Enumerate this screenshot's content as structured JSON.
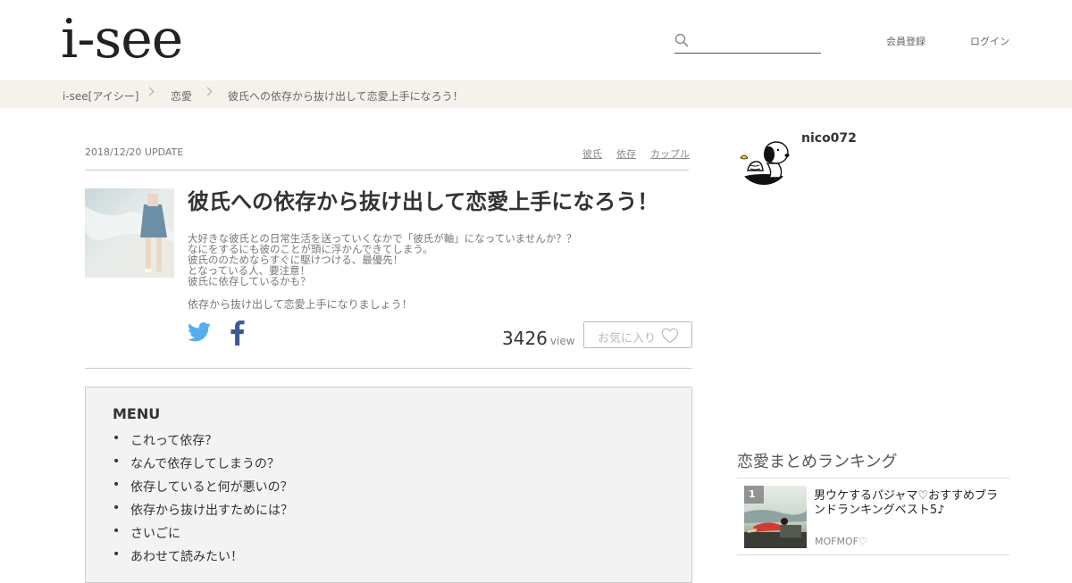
{
  "header": {
    "logo": "i-see",
    "search": {
      "placeholder": ""
    },
    "register_label": "会員登録",
    "login_label": "ログイン"
  },
  "breadcrumb": [
    "i-see[アイシー]",
    "恋愛",
    "彼氏への依存から抜け出して恋愛上手になろう！"
  ],
  "article": {
    "date": "2018/12/20 UPDATE",
    "tags": [
      "彼氏",
      "依存",
      "カップル"
    ],
    "title": "彼氏への依存から抜け出して恋愛上手になろう！",
    "intro_lines": [
      "大好きな彼氏との日常生活を送っていくなかで「彼氏が軸」になっていませんか？？",
      "なにをするにも彼のことが頭に浮かんできてしまう。",
      "彼氏ののためならすぐに駆けつける、最優先！",
      "となっている人、要注意！",
      "彼氏に依存しているかも？"
    ],
    "intro_last": "依存から抜け出して恋愛上手になりましょう！",
    "views": "3426",
    "views_label": "view",
    "favorite_label": "お気に入り",
    "share_icons": [
      "twitter-icon",
      "facebook-icon"
    ]
  },
  "menu": {
    "title": "MENU",
    "items": [
      "これって依存？",
      "なんで依存してしまうの？",
      "依存していると何が悪いの？",
      "依存から抜け出すためには？",
      "さいごに",
      "あわせて読みたい！"
    ]
  },
  "sidebar": {
    "author_name": "nico072",
    "ranking_title": "恋愛まとめランキング",
    "ranking": [
      {
        "rank": "1",
        "title": "男ウケするパジャマ♡おすすめブランドランキングベスト5♪",
        "author": "MOFMOF♡"
      }
    ]
  },
  "colors": {
    "breadcrumb_bg": "#f5f2ec",
    "twitter": "#55acee",
    "facebook": "#3b5998",
    "menu_bg": "#f3f3f3"
  }
}
